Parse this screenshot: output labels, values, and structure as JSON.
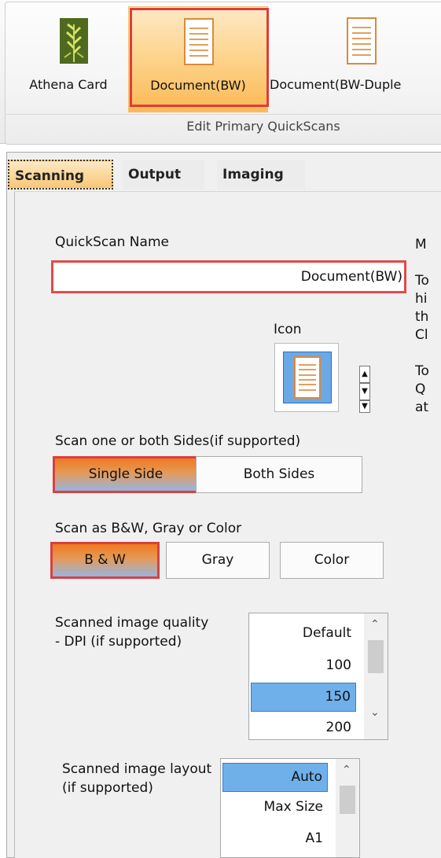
{
  "ribbon": {
    "buttons": [
      {
        "label": "Athena Card",
        "icon": "grass-icon"
      },
      {
        "label": "Document(BW)",
        "icon": "document-icon"
      },
      {
        "label": "Document(BW-Duple",
        "icon": "document-icon"
      }
    ],
    "group_label": "Edit Primary QuickScans"
  },
  "tabs": [
    "Scanning",
    "Output",
    "Imaging"
  ],
  "form": {
    "name_label": "QuickScan Name",
    "name_value": "Document(BW)",
    "right_text": "M\n\nTo\nhi\nth\nCl\n\nTo\nQ\nat",
    "icon_label": "Icon",
    "sides_label": "Scan one or both Sides(if supported)",
    "single_side": "Single Side",
    "both_sides": "Both Sides",
    "color_label": "Scan as B&W, Gray or Color",
    "bw": "B & W",
    "gray": "Gray",
    "color": "Color",
    "dpi_label": "Scanned image quality - DPI (if supported)",
    "dpi_options": [
      "Default",
      "100",
      "150",
      "200"
    ],
    "dpi_selected": "150",
    "layout_label": "Scanned image layout (if supported)",
    "layout_options": [
      "Auto",
      "Max Size",
      "A1"
    ],
    "layout_selected": "Auto"
  },
  "colors": {
    "selection_outline": "#e03b3b",
    "list_selection": "#6fb0ea",
    "active_tab": "#f8c776"
  }
}
